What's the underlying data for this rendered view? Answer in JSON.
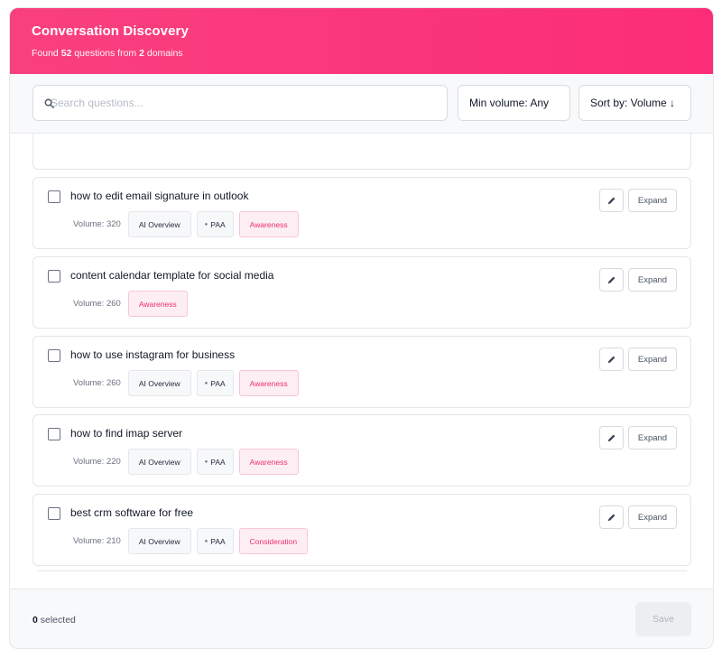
{
  "header": {
    "title": "Conversation Discovery",
    "subtitle_prefix": "Found ",
    "question_count": "52",
    "subtitle_middle": " questions from ",
    "domain_count": "2",
    "subtitle_suffix": " domains",
    "gradient_colors": [
      "#f9407f",
      "#fb2d77"
    ]
  },
  "toolbar": {
    "search_placeholder": "Search questions...",
    "min_volume_label": "Min volume: Any",
    "sort_label": "Sort by: Volume ↓"
  },
  "buttons": {
    "expand_label": "Expand",
    "edit_icon": "pencil-icon"
  },
  "questions": [
    {
      "text": "how to edit email signature in outlook",
      "volume": "Volume: 320",
      "tags": [
        "AI Overview",
        "PAA"
      ],
      "stage": "Awareness",
      "checked": false
    },
    {
      "text": "content calendar template for social media",
      "volume": "Volume: 260",
      "tags": [],
      "stage": "Awareness",
      "checked": false
    },
    {
      "text": "how to use instagram for business",
      "volume": "Volume: 260",
      "tags": [
        "AI Overview",
        "PAA"
      ],
      "stage": "Awareness",
      "checked": false
    },
    {
      "text": "how to find imap server",
      "volume": "Volume: 220",
      "tags": [
        "AI Overview",
        "PAA"
      ],
      "stage": "Awareness",
      "checked": false
    },
    {
      "text": "best crm software for free",
      "volume": "Volume: 210",
      "tags": [
        "AI Overview",
        "PAA"
      ],
      "stage": "Consideration",
      "checked": false
    }
  ],
  "footer": {
    "selected_count": "0",
    "selected_label": " selected",
    "save_label": "Save"
  },
  "colors": {
    "accent": "#f9407f",
    "stage_text": "#ec2f74",
    "stage_bg": "#fdeef4"
  }
}
